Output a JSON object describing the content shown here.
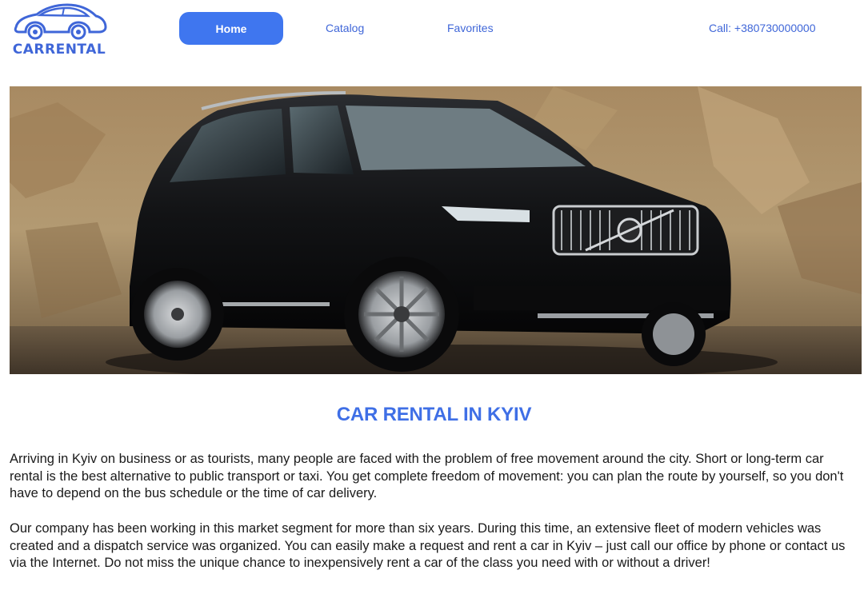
{
  "header": {
    "logo_text": "CARRENTAL",
    "nav": {
      "home": "Home",
      "catalog": "Catalog",
      "favorites": "Favorites"
    },
    "phone": "Call: +380730000000"
  },
  "hero": {
    "icon": "suv-car-photo"
  },
  "main": {
    "title": "CAR RENTAL IN KYIV",
    "paragraphs": [
      "Arriving in Kyiv on business or as tourists, many people are faced with the problem of free movement around the city. Short or long-term car rental is the best alternative to public transport or taxi. You get complete freedom of movement: you can plan the route by yourself, so you don't have to depend on the bus schedule or the time of car delivery.",
      "Our company has been working in this market segment for more than six years. During this time, an extensive fleet of modern vehicles was created and a dispatch service was organized. You can easily make a request and rent a car in Kyiv – just call our office by phone or contact us via the Internet. Do not miss the unique chance to inexpensively rent a car of the class you need with or without a driver!"
    ]
  },
  "colors": {
    "accent": "#3f76ef",
    "brand_text": "#3f66d8"
  }
}
